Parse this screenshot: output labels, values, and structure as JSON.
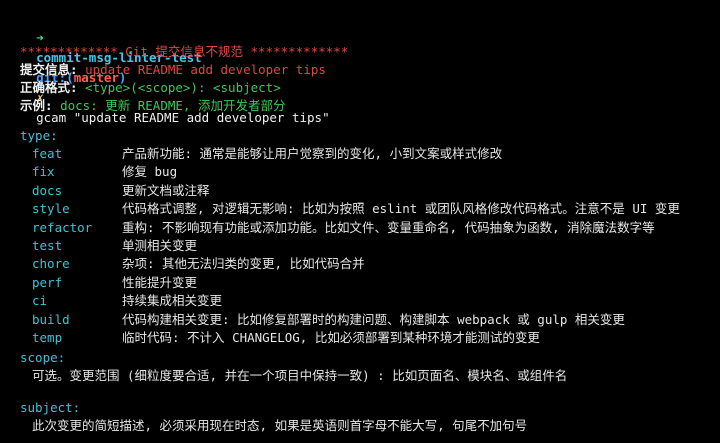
{
  "prompt": {
    "arrow": "➜",
    "dir": "commit-msg-linter-test",
    "git": "git:(",
    "branch": "master",
    "git_close": ")",
    "dirty": "✗",
    "command": "gcam \"update README add developer tips\""
  },
  "banner": "************* Git 提交信息不规范 *************",
  "info": {
    "msg_label": "提交信息:",
    "msg_value": "update README add developer tips",
    "format_label": "正确格式:",
    "format_value": "<type>(<scope>): <subject>",
    "example_label": "示例:",
    "example_value": "docs: 更新 README, 添加开发者部分"
  },
  "type_header": "type:",
  "types": [
    {
      "key": "feat",
      "desc": "产品新功能: 通常是能够让用户觉察到的变化, 小到文案或样式修改"
    },
    {
      "key": "fix",
      "desc": "修复 bug"
    },
    {
      "key": "docs",
      "desc": "更新文档或注释"
    },
    {
      "key": "style",
      "desc": "代码格式调整, 对逻辑无影响: 比如为按照 eslint 或团队风格修改代码格式。注意不是 UI 变更"
    },
    {
      "key": "refactor",
      "desc": "重构: 不影响现有功能或添加功能。比如文件、变量重命名, 代码抽象为函数, 消除魔法数字等"
    },
    {
      "key": "test",
      "desc": "单测相关变更"
    },
    {
      "key": "chore",
      "desc": "杂项: 其他无法归类的变更, 比如代码合并"
    },
    {
      "key": "perf",
      "desc": "性能提升变更"
    },
    {
      "key": "ci",
      "desc": "持续集成相关变更"
    },
    {
      "key": "build",
      "desc": "代码构建相关变更: 比如修复部署时的构建问题、构建脚本 webpack 或 gulp 相关变更"
    },
    {
      "key": "temp",
      "desc": "临时代码: 不计入 CHANGELOG, 比如必须部署到某种环境才能测试的变更"
    }
  ],
  "scope_header": "scope:",
  "scope_desc": "可选。变更范围 (细粒度要合适, 并在一个项目中保持一致) : 比如页面名、模块名、或组件名",
  "subject_header": "subject:",
  "subject_desc": "此次变更的简短描述, 必须采用现在时态, 如果是英语则首字母不能大写, 句尾不加句号"
}
